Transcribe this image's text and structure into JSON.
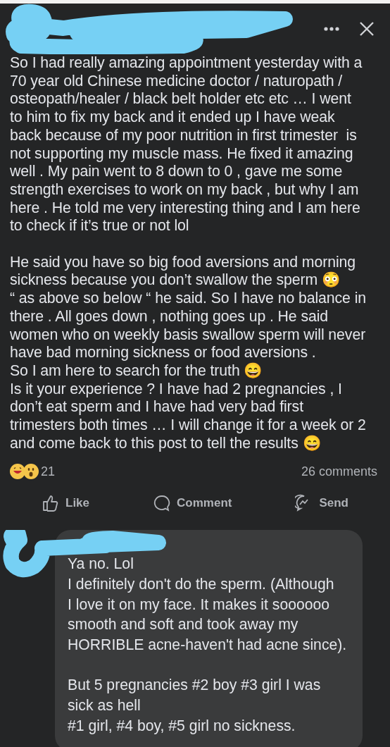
{
  "post": {
    "paragraphs": [
      "So I had really amazing appointment yesterday with a\n70 year old Chinese medicine doctor / naturopath /\nosteopath/healer / black belt holder etc etc … I went\nto him to fix my back and it ended up I have weak\nback because of my poor nutrition in first trimester  is\nnot supporting my muscle mass. He fixed it amazing\nwell . My pain went to 8 down to 0 , gave me some\nstrength exercises to work on my back , but why I am\nhere . He told me very interesting thing and I am here\nto check if it’s true or not lol",
      "He said you have so big food aversions and morning\nsickness because you don’t swallow the sperm 😳\n“ as above so below “ he said. So I have no balance in\nthere . All goes down , nothing goes up . He said\nwomen who on weekly basis swallow sperm will never\nhave bad morning sickness or food aversions .\nSo I am here to search for the truth 😄\nIs it your experience ? I have had 2 pregnancies , I\ndon’t eat sperm and I have had very bad first\ntrimesters both times … I will change it for a week or 2\nand come back to this post to tell the results 😄"
    ],
    "reaction_count": "21",
    "comment_count": "26 comments",
    "actions": [
      {
        "kind": "like",
        "label": "Like"
      },
      {
        "kind": "comment",
        "label": "Comment"
      },
      {
        "kind": "send",
        "label": "Send"
      }
    ]
  },
  "comment": {
    "paragraphs": [
      "Ya no. Lol\nI definitely don't do the sperm. (Although\nI love it on my face. It makes it soooooo\nsmooth and soft and took away my\nHORRIBLE acne-haven't had acne since).",
      "But 5 pregnancies #2 boy #3 girl I was\nsick as hell\n#1 girl, #4 boy, #5 girl no sickness."
    ]
  }
}
